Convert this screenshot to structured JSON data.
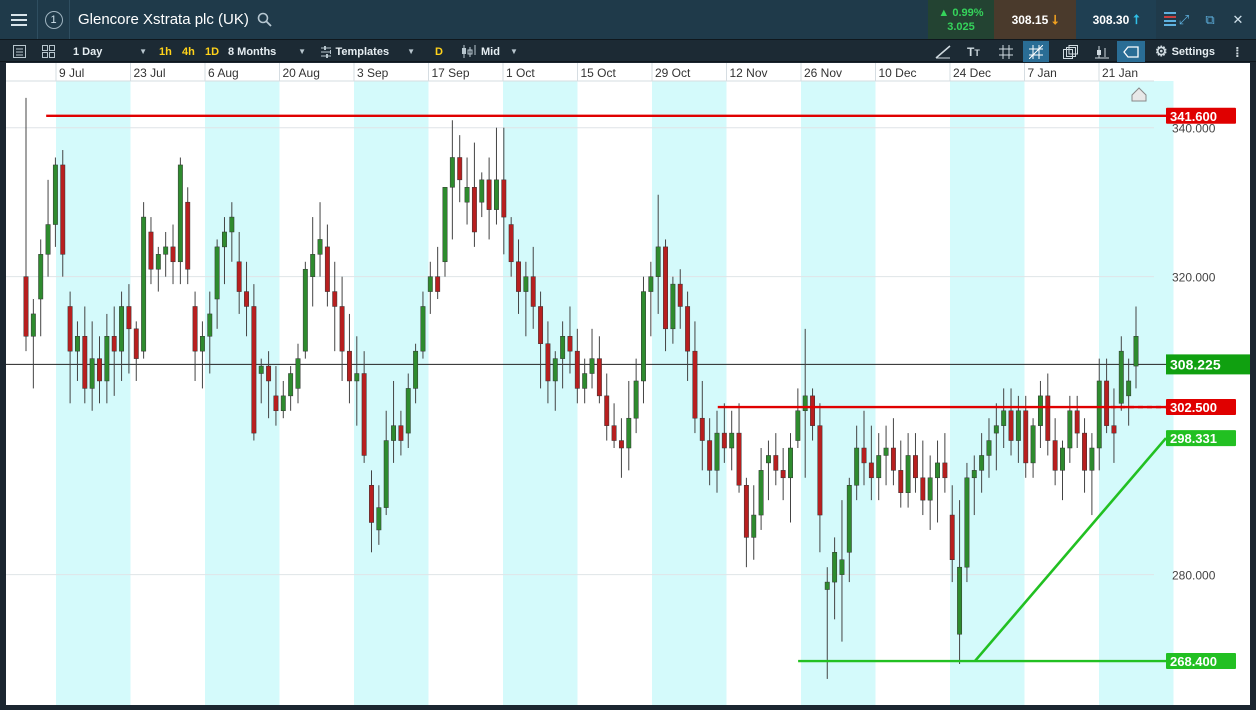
{
  "header": {
    "instrument": "Glencore Xstrata plc (UK)",
    "badge": "1",
    "change_pct": "▲ 0.99%",
    "change_abs": "3.025",
    "sell": "308.15",
    "buy": "308.30"
  },
  "toolbar": {
    "interval": "1 Day",
    "quick_1h": "1h",
    "quick_4h": "4h",
    "quick_1d": "1D",
    "range": "8 Months",
    "templates": "Templates",
    "style_d": "D",
    "price_type": "Mid",
    "settings": "Settings"
  },
  "colors": {
    "up": "#2e8b2e",
    "down": "#b81f1f",
    "resistance": "#e00000",
    "support": "#22c022",
    "current": "#10a010"
  },
  "chart_data": {
    "type": "candlestick",
    "ylim": [
      262.5,
      346.0
    ],
    "yticks": [
      "340.000",
      "320.000",
      "280.000"
    ],
    "ytick_values": [
      340,
      320,
      280
    ],
    "x_labels": [
      "9 Jul",
      "23 Jul",
      "6 Aug",
      "20 Aug",
      "3 Sep",
      "17 Sep",
      "1 Oct",
      "15 Oct",
      "29 Oct",
      "12 Nov",
      "26 Nov",
      "10 Dec",
      "24 Dec",
      "7 Jan",
      "21 Jan"
    ],
    "current_price": {
      "value": 308.225,
      "label": "308.225"
    },
    "levels": [
      {
        "name": "resistance-341-6",
        "value": 341.6,
        "label": "341.600",
        "color": "#e00000",
        "start": 0.035
      },
      {
        "name": "resistance-302-5",
        "value": 302.5,
        "label": "302.500",
        "color": "#e00000",
        "start": 0.62
      },
      {
        "name": "support-268-4",
        "value": 268.4,
        "label": "268.400",
        "color": "#22c022",
        "start": 0.69
      }
    ],
    "trendline": {
      "from": 268.4,
      "to": 298.331,
      "label": "298.331",
      "start": 0.79
    },
    "candles": [
      [
        320,
        344,
        310,
        312
      ],
      [
        312,
        317,
        305,
        315
      ],
      [
        317,
        325,
        312,
        323
      ],
      [
        323,
        333,
        320,
        327
      ],
      [
        327,
        336,
        324,
        335
      ],
      [
        335,
        337,
        320,
        323
      ],
      [
        316,
        318,
        303,
        310
      ],
      [
        310,
        314,
        306,
        312
      ],
      [
        312,
        316,
        303,
        305
      ],
      [
        305,
        314,
        302,
        309
      ],
      [
        309,
        312,
        303,
        306
      ],
      [
        306,
        315,
        303,
        312
      ],
      [
        312,
        316,
        304,
        310
      ],
      [
        310,
        318,
        306,
        316
      ],
      [
        316,
        319,
        307,
        313
      ],
      [
        313,
        314,
        306,
        309
      ],
      [
        310,
        330,
        309,
        328
      ],
      [
        326,
        328,
        319,
        321
      ],
      [
        321,
        324,
        318,
        323
      ],
      [
        323,
        326,
        320,
        324
      ],
      [
        324,
        327,
        319,
        322
      ],
      [
        322,
        336,
        319,
        335
      ],
      [
        330,
        332,
        319,
        321
      ],
      [
        316,
        318,
        306,
        310
      ],
      [
        310,
        314,
        305,
        312
      ],
      [
        312,
        318,
        307,
        315
      ],
      [
        317,
        325,
        313,
        324
      ],
      [
        324,
        328,
        319,
        326
      ],
      [
        326,
        330,
        322,
        328
      ],
      [
        322,
        326,
        315,
        318
      ],
      [
        318,
        322,
        312,
        316
      ],
      [
        316,
        319,
        298,
        299
      ],
      [
        307,
        309,
        303,
        308
      ],
      [
        308,
        310,
        301,
        306
      ],
      [
        304,
        308,
        300,
        302
      ],
      [
        302,
        306,
        301,
        304
      ],
      [
        304,
        308,
        302,
        307
      ],
      [
        305,
        311,
        303,
        309
      ],
      [
        310,
        322,
        309,
        321
      ],
      [
        320,
        328,
        316,
        323
      ],
      [
        323,
        330,
        320,
        325
      ],
      [
        324,
        327,
        316,
        318
      ],
      [
        318,
        322,
        310,
        316
      ],
      [
        316,
        320,
        306,
        310
      ],
      [
        310,
        315,
        303,
        306
      ],
      [
        306,
        312,
        300,
        307
      ],
      [
        307,
        310,
        295,
        296
      ],
      [
        292,
        294,
        283,
        287
      ],
      [
        286,
        292,
        284,
        289
      ],
      [
        289,
        302,
        288,
        298
      ],
      [
        298,
        306,
        295,
        300
      ],
      [
        300,
        302,
        296,
        298
      ],
      [
        299,
        307,
        297,
        305
      ],
      [
        305,
        311,
        303,
        310
      ],
      [
        310,
        318,
        309,
        316
      ],
      [
        318,
        322,
        315,
        320
      ],
      [
        320,
        324,
        317,
        318
      ],
      [
        322,
        330,
        320,
        332
      ],
      [
        332,
        341,
        325,
        336
      ],
      [
        336,
        339,
        330,
        333
      ],
      [
        330,
        336,
        327,
        332
      ],
      [
        332,
        338,
        324,
        326
      ],
      [
        330,
        334,
        328,
        333
      ],
      [
        333,
        336,
        325,
        329
      ],
      [
        329,
        340,
        327,
        333
      ],
      [
        333,
        340,
        323,
        328
      ],
      [
        327,
        328,
        320,
        322
      ],
      [
        322,
        325,
        315,
        318
      ],
      [
        318,
        322,
        312,
        320
      ],
      [
        320,
        324,
        313,
        316
      ],
      [
        316,
        318,
        305,
        311
      ],
      [
        311,
        314,
        303,
        306
      ],
      [
        306,
        310,
        302,
        309
      ],
      [
        309,
        314,
        305,
        312
      ],
      [
        312,
        316,
        307,
        310
      ],
      [
        310,
        313,
        303,
        305
      ],
      [
        305,
        309,
        303,
        307
      ],
      [
        307,
        313,
        305,
        309
      ],
      [
        309,
        312,
        303,
        304
      ],
      [
        304,
        307,
        298,
        300
      ],
      [
        300,
        303,
        297,
        298
      ],
      [
        298,
        301,
        293,
        297
      ],
      [
        297,
        306,
        294,
        301
      ],
      [
        301,
        309,
        299,
        306
      ],
      [
        306,
        320,
        303,
        318
      ],
      [
        318,
        322,
        312,
        320
      ],
      [
        320,
        331,
        315,
        324
      ],
      [
        324,
        325,
        310,
        313
      ],
      [
        313,
        320,
        311,
        319
      ],
      [
        319,
        321,
        313,
        316
      ],
      [
        316,
        318,
        306,
        310
      ],
      [
        310,
        314,
        299,
        301
      ],
      [
        301,
        306,
        294,
        298
      ],
      [
        298,
        301,
        292,
        294
      ],
      [
        294,
        302,
        291,
        299
      ],
      [
        299,
        303,
        295,
        297
      ],
      [
        297,
        302,
        294,
        299
      ],
      [
        299,
        303,
        291,
        292
      ],
      [
        292,
        293,
        281,
        285
      ],
      [
        285,
        292,
        282,
        288
      ],
      [
        288,
        297,
        286,
        294
      ],
      [
        295,
        298,
        290,
        296
      ],
      [
        296,
        299,
        292,
        294
      ],
      [
        294,
        297,
        290,
        293
      ],
      [
        293,
        299,
        287,
        297
      ],
      [
        298,
        305,
        297,
        302
      ],
      [
        302,
        313,
        293,
        304
      ],
      [
        304,
        305,
        298,
        300
      ],
      [
        300,
        303,
        283,
        288
      ],
      [
        278,
        281,
        266,
        279
      ],
      [
        279,
        285,
        274,
        283
      ],
      [
        280,
        290,
        271,
        282
      ],
      [
        283,
        293,
        279,
        292
      ],
      [
        292,
        300,
        290,
        297
      ],
      [
        297,
        302,
        292,
        295
      ],
      [
        295,
        300,
        290,
        293
      ],
      [
        293,
        299,
        290,
        296
      ],
      [
        296,
        300,
        292,
        297
      ],
      [
        297,
        301,
        292,
        294
      ],
      [
        294,
        298,
        289,
        291
      ],
      [
        291,
        299,
        289,
        296
      ],
      [
        296,
        299,
        291,
        293
      ],
      [
        293,
        298,
        288,
        290
      ],
      [
        290,
        296,
        286,
        293
      ],
      [
        293,
        298,
        287,
        295
      ],
      [
        295,
        299,
        291,
        293
      ],
      [
        288,
        292,
        279,
        282
      ],
      [
        272,
        290,
        268,
        281
      ],
      [
        281,
        295,
        279,
        293
      ],
      [
        293,
        296,
        288,
        294
      ],
      [
        294,
        299,
        291,
        296
      ],
      [
        296,
        301,
        293,
        298
      ],
      [
        299,
        303,
        294,
        300
      ],
      [
        300,
        305,
        297,
        302
      ],
      [
        302,
        305,
        296,
        298
      ],
      [
        298,
        304,
        295,
        302
      ],
      [
        302,
        304,
        293,
        295
      ],
      [
        295,
        301,
        293,
        300
      ],
      [
        300,
        306,
        297,
        304
      ],
      [
        304,
        307,
        296,
        298
      ],
      [
        298,
        301,
        292,
        294
      ],
      [
        294,
        298,
        290,
        297
      ],
      [
        297,
        304,
        295,
        302
      ],
      [
        302,
        304,
        297,
        299
      ],
      [
        299,
        301,
        291,
        294
      ],
      [
        294,
        299,
        288,
        297
      ],
      [
        297,
        309,
        294,
        306
      ],
      [
        306,
        309,
        299,
        300
      ],
      [
        300,
        305,
        295,
        299
      ],
      [
        303,
        312,
        302,
        310
      ],
      [
        304,
        309,
        300,
        306
      ],
      [
        308,
        316,
        305,
        312
      ]
    ]
  }
}
